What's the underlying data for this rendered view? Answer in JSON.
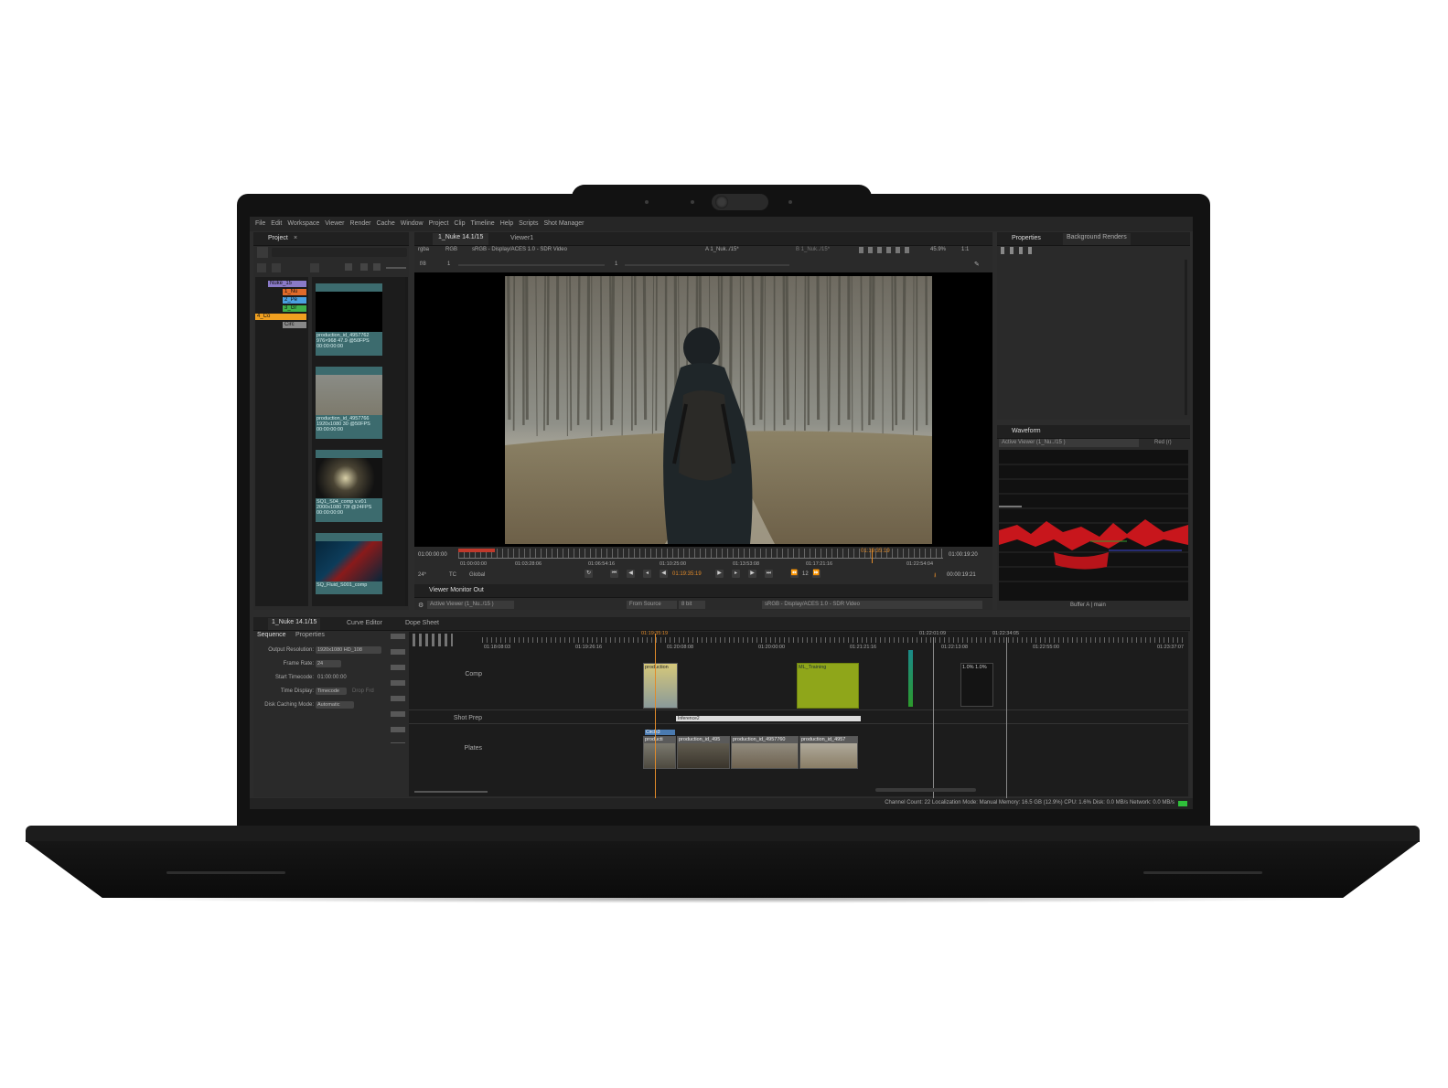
{
  "menu": [
    "File",
    "Edit",
    "Workspace",
    "Viewer",
    "Render",
    "Cache",
    "Window",
    "Project",
    "Clip",
    "Timeline",
    "Help",
    "Scripts",
    "Shot Manager"
  ],
  "project_panel": {
    "tab": "Project",
    "tree": [
      {
        "label": "Nuke_15",
        "color": "#8a7ac8"
      },
      {
        "label": "1_Nu",
        "color": "#e06a2a"
      },
      {
        "label": "2_Pe",
        "color": "#4aa0e0"
      },
      {
        "label": "3_Gr",
        "color": "#3fb04a"
      },
      {
        "label": "4_Co",
        "color": "#f0a020"
      },
      {
        "label": "Circ",
        "color": "#888888"
      }
    ],
    "clips": [
      {
        "name": "production_id_4957762",
        "meta": "976×968 47.9 @50FPS",
        "tc": "00:00:00:00"
      },
      {
        "name": "production_id_4957766",
        "meta": "1920x1080 30 @50FPS",
        "tc": "00:00:00:00"
      },
      {
        "name": "SQ1_S04_comp v.v01",
        "meta": "2000x1080 73f @24FPS",
        "tc": "00:00:00:00"
      },
      {
        "name": "SQ_Fluid_S001_comp",
        "meta": "2048x1152 117 @24FPS",
        "tc": "00:00:23:00"
      }
    ]
  },
  "viewer": {
    "tabs": [
      "1_Nuke 14.1/15",
      "Viewer1"
    ],
    "channel": "rgba",
    "colorspace_short": "RGB",
    "display": "sRGB - Display/ACES 1.0 - SDR Video",
    "input_a": "A  1_Nuk../15*",
    "input_b": "B  1_Nuk../15*",
    "zoom": "45.9%",
    "ratio": "1:1",
    "fstop": "f/8",
    "frame_in": "1",
    "frame_out": "1",
    "tc_start": "01:00:00:00",
    "tc_end": "01:00:19:20",
    "tc_ticks": [
      "01:00:00:00",
      "01:03:28:06",
      "01:06:54:16",
      "01:10:25:00",
      "01:13:53:08",
      "01:17:21:16",
      "01:22:54:04"
    ],
    "fps": "24*",
    "tc_mode": "TC",
    "scope": "Global",
    "current_tc": "01:19:35:19",
    "playhead_label": "01:19:35:19",
    "step": "12",
    "duration_tc": "00:00:19:21",
    "monitor_tab": "Viewer Monitor Out",
    "monitor_source": "Active Viewer (1_Nu../15 )",
    "monitor_from": "From Source",
    "monitor_bit": "8 bit",
    "monitor_display": "sRGB - Display/ACES 1.0 - SDR Video"
  },
  "properties_panel": {
    "tabs": [
      "Properties",
      "Background Renders"
    ]
  },
  "waveform_panel": {
    "tab": "Waveform",
    "source": "Active Viewer (1_Nu../15 )",
    "channel": "Red (r)",
    "footer": "Buffer A | main"
  },
  "timeline": {
    "tabs": [
      "1_Nuke 14.1/15",
      "Curve Editor",
      "Dope Sheet"
    ],
    "subtabs": [
      "Sequence",
      "Properties"
    ],
    "props": [
      {
        "label": "Output Resolution:",
        "value": "1920x1080 HD_108"
      },
      {
        "label": "Frame Rate:",
        "value": "24"
      },
      {
        "label": "Start Timecode:",
        "value": "01:00:00:00"
      },
      {
        "label": "Time Display:",
        "value": "Timecode"
      },
      {
        "label": "Disk Caching Mode:",
        "value": "Automatic"
      }
    ],
    "drop_frame": "Drop Frd",
    "ruler_top": [
      "01:19:35:19",
      "01:22:01:09",
      "01:22:34:05"
    ],
    "ruler": [
      "01:18:08:03",
      "01:19:26:16",
      "01:20:08:08",
      "01:20:00:00",
      "01:21:21:16",
      "01:22:13:08",
      "01:22:55:00",
      "01:23:37:07"
    ],
    "tracks": [
      "Comp",
      "Shot Prep",
      "Plates"
    ],
    "comp_clips": [
      {
        "label": "production"
      },
      {
        "label": "ML_Training"
      },
      {
        "label": "1.0%  1.0%"
      }
    ],
    "shotprep_clip": "Inference2",
    "circle_label": "Circle3",
    "plate_clips": [
      "producti",
      "production_id_495",
      "production_id_4957760",
      "production_id_4957"
    ]
  },
  "status_bar": "Channel Count: 22  Localization Mode: Manual  Memory: 16.5 GB (12.9%)  CPU: 1.6%  Disk: 0.0 MB/s  Network: 0.0 MB/s"
}
